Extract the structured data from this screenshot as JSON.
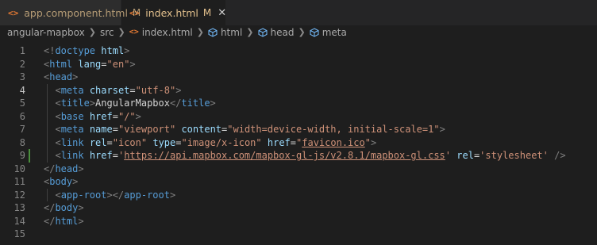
{
  "tabs": [
    {
      "icon": "<>",
      "label": "app.component.html",
      "badge": "M",
      "active": false
    },
    {
      "icon": "<>",
      "label": "index.html",
      "badge": "M",
      "active": true,
      "close": "✕"
    }
  ],
  "breadcrumb": {
    "folder": "angular-mapbox",
    "subfolder": "src",
    "file": "index.html",
    "sym1": "html",
    "sym2": "head",
    "sym3": "meta",
    "file_icon": "<>"
  },
  "editor": {
    "line_numbers": [
      "1",
      "2",
      "3",
      "4",
      "5",
      "6",
      "7",
      "8",
      "9",
      "10",
      "11",
      "12",
      "13",
      "14",
      "15"
    ],
    "current_line": "4",
    "modified_line": "9",
    "lines": [
      {
        "indent": "",
        "tokens": [
          [
            "p",
            "<!"
          ],
          [
            "tag",
            "doctype"
          ],
          [
            "t",
            " "
          ],
          [
            "attr",
            "html"
          ],
          [
            "p",
            ">"
          ]
        ]
      },
      {
        "indent": "",
        "tokens": [
          [
            "p",
            "<"
          ],
          [
            "tag",
            "html"
          ],
          [
            "t",
            " "
          ],
          [
            "attr",
            "lang"
          ],
          [
            "t",
            "="
          ],
          [
            "str",
            "\"en\""
          ],
          [
            "p",
            ">"
          ]
        ]
      },
      {
        "indent": "",
        "tokens": [
          [
            "p",
            "<"
          ],
          [
            "tag",
            "head"
          ],
          [
            "p",
            ">"
          ]
        ]
      },
      {
        "indent": "  ",
        "tokens": [
          [
            "p",
            "<"
          ],
          [
            "tag",
            "meta"
          ],
          [
            "t",
            " "
          ],
          [
            "attr",
            "charset"
          ],
          [
            "t",
            "="
          ],
          [
            "str",
            "\"utf-8\""
          ],
          [
            "p",
            ">"
          ]
        ]
      },
      {
        "indent": "  ",
        "tokens": [
          [
            "p",
            "<"
          ],
          [
            "tag",
            "title"
          ],
          [
            "p",
            ">"
          ],
          [
            "t",
            "AngularMapbox"
          ],
          [
            "p",
            "</"
          ],
          [
            "tag",
            "title"
          ],
          [
            "p",
            ">"
          ]
        ]
      },
      {
        "indent": "  ",
        "tokens": [
          [
            "p",
            "<"
          ],
          [
            "tag",
            "base"
          ],
          [
            "t",
            " "
          ],
          [
            "attr",
            "href"
          ],
          [
            "t",
            "="
          ],
          [
            "str",
            "\"/\""
          ],
          [
            "p",
            ">"
          ]
        ]
      },
      {
        "indent": "  ",
        "tokens": [
          [
            "p",
            "<"
          ],
          [
            "tag",
            "meta"
          ],
          [
            "t",
            " "
          ],
          [
            "attr",
            "name"
          ],
          [
            "t",
            "="
          ],
          [
            "str",
            "\"viewport\""
          ],
          [
            "t",
            " "
          ],
          [
            "attr",
            "content"
          ],
          [
            "t",
            "="
          ],
          [
            "str",
            "\"width=device-width, initial-scale=1\""
          ],
          [
            "p",
            ">"
          ]
        ]
      },
      {
        "indent": "  ",
        "tokens": [
          [
            "p",
            "<"
          ],
          [
            "tag",
            "link"
          ],
          [
            "t",
            " "
          ],
          [
            "attr",
            "rel"
          ],
          [
            "t",
            "="
          ],
          [
            "str",
            "\"icon\""
          ],
          [
            "t",
            " "
          ],
          [
            "attr",
            "type"
          ],
          [
            "t",
            "="
          ],
          [
            "str",
            "\"image/x-icon\""
          ],
          [
            "t",
            " "
          ],
          [
            "attr",
            "href"
          ],
          [
            "t",
            "="
          ],
          [
            "str",
            "\""
          ],
          [
            "link",
            "favicon.ico"
          ],
          [
            "str",
            "\""
          ],
          [
            "p",
            ">"
          ]
        ]
      },
      {
        "indent": "  ",
        "tokens": [
          [
            "p",
            "<"
          ],
          [
            "tag",
            "link"
          ],
          [
            "t",
            " "
          ],
          [
            "attr",
            "href"
          ],
          [
            "t",
            "="
          ],
          [
            "str",
            "'"
          ],
          [
            "link",
            "https://api.mapbox.com/mapbox-gl-js/v2.8.1/mapbox-gl.css"
          ],
          [
            "str",
            "'"
          ],
          [
            "t",
            " "
          ],
          [
            "attr",
            "rel"
          ],
          [
            "t",
            "="
          ],
          [
            "str",
            "'stylesheet'"
          ],
          [
            "t",
            " "
          ],
          [
            "p",
            "/>"
          ]
        ]
      },
      {
        "indent": "",
        "tokens": [
          [
            "p",
            "</"
          ],
          [
            "tag",
            "head"
          ],
          [
            "p",
            ">"
          ]
        ]
      },
      {
        "indent": "",
        "tokens": [
          [
            "p",
            "<"
          ],
          [
            "tag",
            "body"
          ],
          [
            "p",
            ">"
          ]
        ]
      },
      {
        "indent": "  ",
        "tokens": [
          [
            "p",
            "<"
          ],
          [
            "tag",
            "app-root"
          ],
          [
            "p",
            "></"
          ],
          [
            "tag",
            "app-root"
          ],
          [
            "p",
            ">"
          ]
        ]
      },
      {
        "indent": "",
        "tokens": [
          [
            "p",
            "</"
          ],
          [
            "tag",
            "body"
          ],
          [
            "p",
            ">"
          ]
        ]
      },
      {
        "indent": "",
        "tokens": [
          [
            "p",
            "</"
          ],
          [
            "tag",
            "html"
          ],
          [
            "p",
            ">"
          ]
        ]
      },
      {
        "indent": "",
        "tokens": []
      }
    ]
  },
  "colors": {
    "background": "#1e1e1e",
    "tag": "#569cd6",
    "attr": "#9cdcfe",
    "string": "#ce9178",
    "punct": "#808080",
    "modified": "#e2c08d",
    "gutter_added": "#4a8e3d"
  }
}
